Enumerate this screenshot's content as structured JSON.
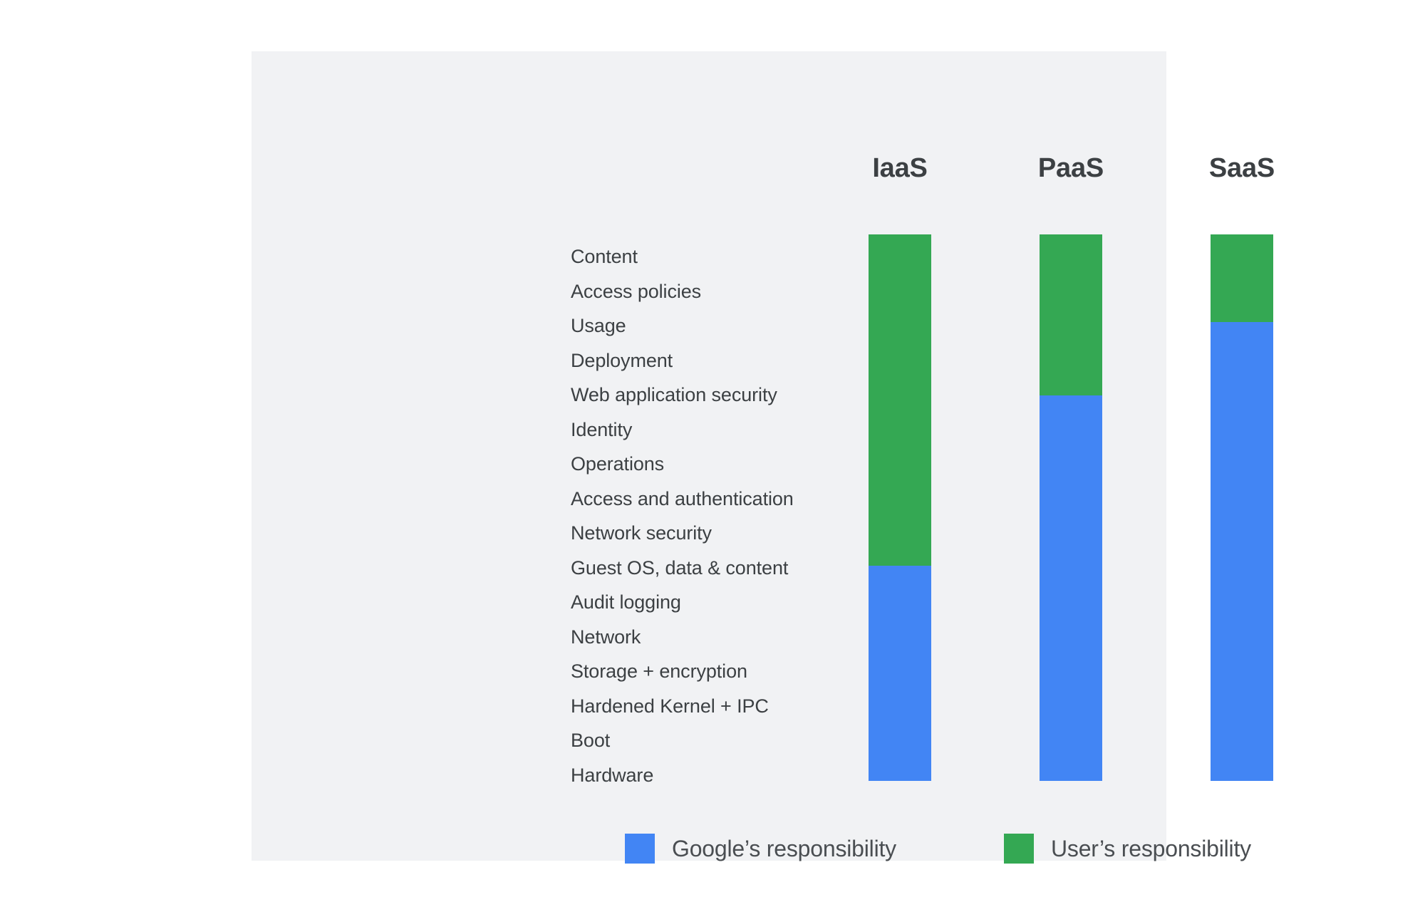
{
  "panel": {
    "background_color": "#f1f2f4"
  },
  "colors": {
    "google_blue": "#4285f4",
    "user_green": "#34a853",
    "text": "#3c4043",
    "panel_bg": "#f1f2f4"
  },
  "columns": [
    {
      "label": "IaaS"
    },
    {
      "label": "PaaS"
    },
    {
      "label": "SaaS"
    }
  ],
  "rows": [
    {
      "label": "Content"
    },
    {
      "label": "Access policies"
    },
    {
      "label": "Usage"
    },
    {
      "label": "Deployment"
    },
    {
      "label": "Web application security"
    },
    {
      "label": "Identity"
    },
    {
      "label": "Operations"
    },
    {
      "label": "Access and authentication"
    },
    {
      "label": "Network security"
    },
    {
      "label": "Guest OS, data & content"
    },
    {
      "label": "Audit logging"
    },
    {
      "label": "Network"
    },
    {
      "label": "Storage + encryption"
    },
    {
      "label": "Hardened Kernel + IPC"
    },
    {
      "label": "Boot"
    },
    {
      "label": "Hardware"
    }
  ],
  "legend": [
    {
      "label": "Google’s responsibility",
      "color": "#4285f4",
      "swatch": "blue"
    },
    {
      "label": "User’s responsibility",
      "color": "#34a853",
      "swatch": "green"
    }
  ],
  "chart_data": {
    "type": "bar",
    "title": "",
    "xlabel": "",
    "ylabel": "",
    "stacked": true,
    "orientation": "vertical",
    "grid": false,
    "legend_position": "bottom",
    "categories": [
      "IaaS",
      "PaaS",
      "SaaS"
    ],
    "row_labels": [
      "Content",
      "Access policies",
      "Usage",
      "Deployment",
      "Web application security",
      "Identity",
      "Operations",
      "Access and authentication",
      "Network security",
      "Guest OS, data & content",
      "Audit logging",
      "Network",
      "Storage + encryption",
      "Hardened Kernel + IPC",
      "Boot",
      "Hardware"
    ],
    "series": [
      {
        "name": "User’s responsibility",
        "color": "#34a853",
        "values": [
          60.6,
          29.5,
          16.0
        ],
        "unit": "percent_of_stack",
        "rows_covered": [
          [
            "Content",
            "Network security"
          ],
          [
            "Content",
            "Operations"
          ],
          [
            "Content",
            "Usage"
          ]
        ]
      },
      {
        "name": "Google’s responsibility",
        "color": "#4285f4",
        "values": [
          39.4,
          70.5,
          84.0
        ],
        "unit": "percent_of_stack",
        "rows_covered": [
          [
            "Guest OS, data & content",
            "Hardware"
          ],
          [
            "Access and authentication",
            "Hardware"
          ],
          [
            "Deployment",
            "Hardware"
          ]
        ]
      }
    ],
    "ylim": [
      0,
      100
    ],
    "notes": "Stacked shared-responsibility bars: green (user) on top, blue (Google) below; boundary falls lower as service model moves IaaS → PaaS → SaaS."
  }
}
